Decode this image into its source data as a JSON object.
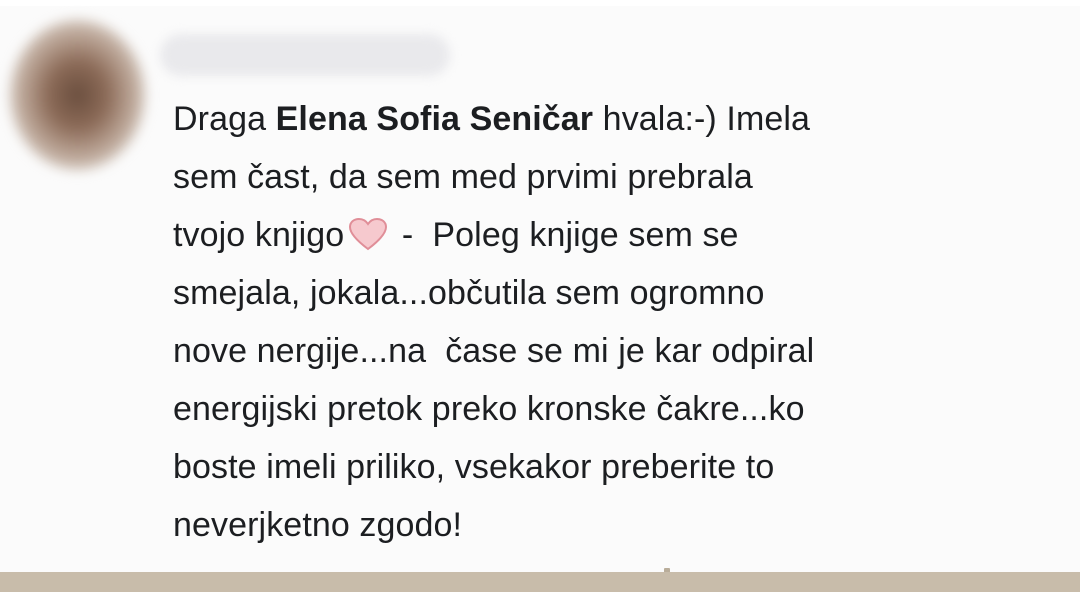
{
  "comment": {
    "author_name_visible": "",
    "lines": {
      "l1_pre": "Draga ",
      "l1_mention": "Elena Sofia Seničar",
      "l1_post": " hvala:-) Imela",
      "l2": "sem čast, da sem med prvimi prebrala",
      "l3_pre": "tvojo knjigo",
      "l3_post": " -  Poleg knjige sem se",
      "l4": "smejala, jokala...občutila sem ogromno",
      "l5": "nove nergije...na  čase se mi je kar odpiral",
      "l6": "energijski pretok preko kronske čakre...ko",
      "l7": "boste imeli priliko, vsekakor preberite to",
      "l8": "neverjketno zgodo!"
    },
    "emoji": "heart-icon",
    "heart_color": "#f2b8bf"
  }
}
